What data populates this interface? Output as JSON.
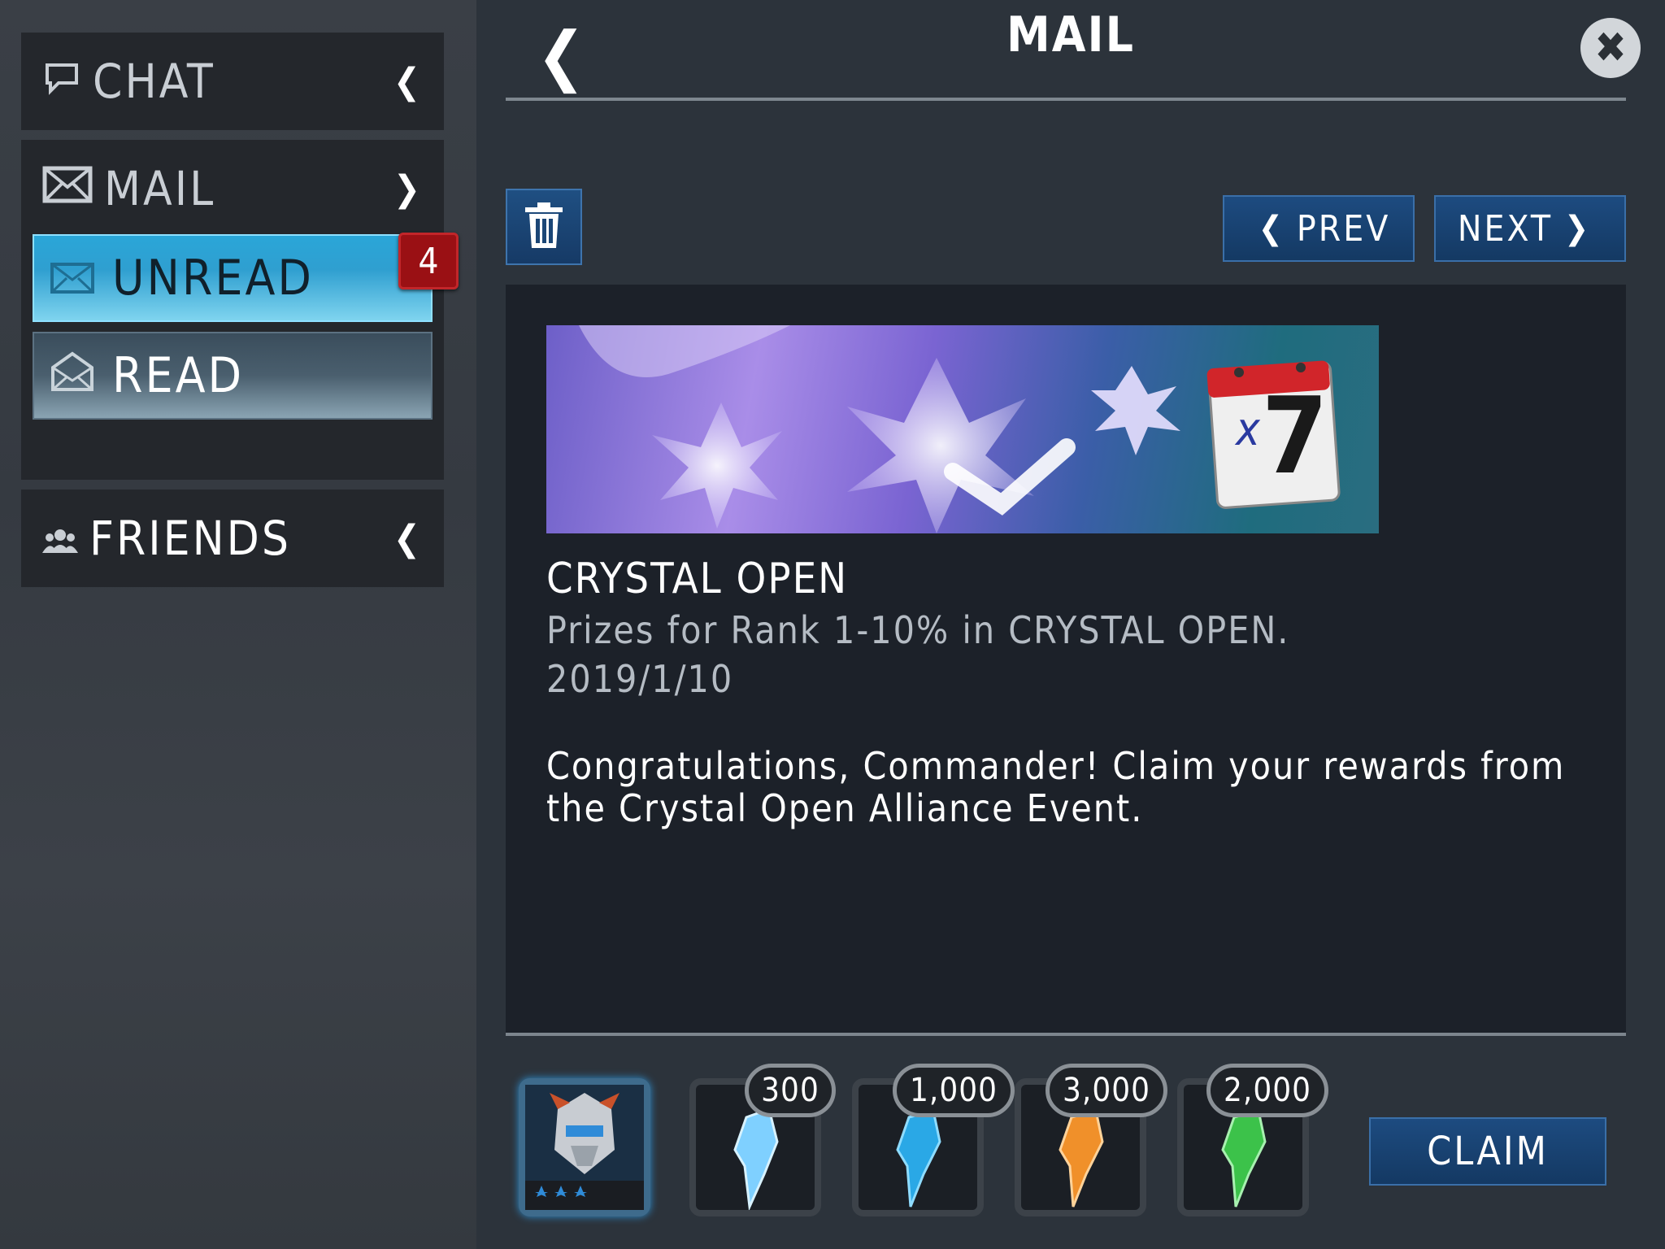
{
  "sidebar": {
    "chat": {
      "label": "CHAT"
    },
    "mail": {
      "label": "MAIL"
    },
    "unread": {
      "label": "UNREAD",
      "badge": "4"
    },
    "read": {
      "label": "READ"
    },
    "friends": {
      "label": "FRIENDS"
    }
  },
  "header": {
    "title": "MAIL"
  },
  "toolbar": {
    "prev_label": "PREV",
    "next_label": "NEXT"
  },
  "mail": {
    "subject": "CRYSTAL OPEN",
    "summary": "Prizes for Rank 1-10% in CRYSTAL OPEN.",
    "date": "2019/1/10",
    "body": "Congratulations, Commander! Claim your rewards from the Crystal Open Alliance Event.",
    "banner_calendar_number": "7",
    "banner_calendar_mark": "x"
  },
  "rewards": [
    {
      "name": "hero-portrait",
      "qty": ""
    },
    {
      "name": "blue-crystal",
      "qty": "300",
      "color": "#7fd0ff"
    },
    {
      "name": "teal-crystal",
      "qty": "1,000",
      "color": "#2aa8e6"
    },
    {
      "name": "orange-crystal",
      "qty": "3,000",
      "color": "#f0902a"
    },
    {
      "name": "green-crystal",
      "qty": "2,000",
      "color": "#3cc24a"
    }
  ],
  "claim_label": "CLAIM",
  "colors": {
    "accent": "#1d4b80",
    "badge": "#9a1014",
    "unread_tab": "#2aa6d8"
  }
}
